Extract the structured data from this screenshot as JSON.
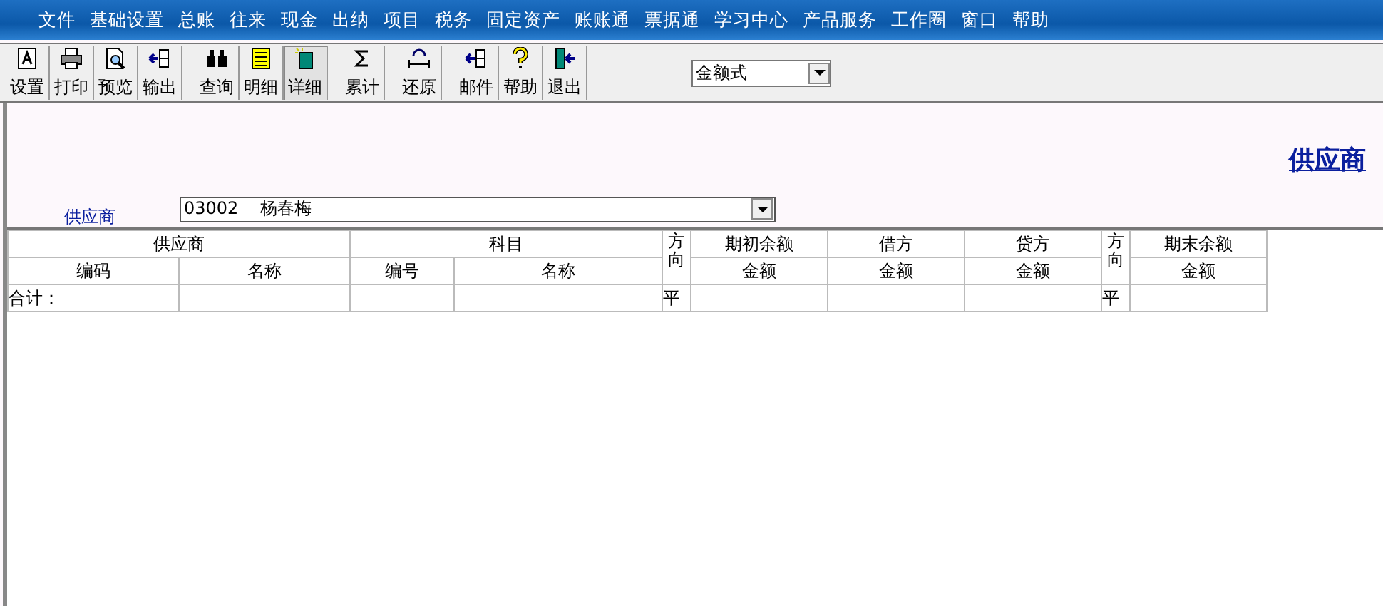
{
  "menu": [
    "文件",
    "基础设置",
    "总账",
    "往来",
    "现金",
    "出纳",
    "项目",
    "税务",
    "固定资产",
    "账账通",
    "票据通",
    "学习中心",
    "产品服务",
    "工作圈",
    "窗口",
    "帮助"
  ],
  "toolbar": [
    [
      {
        "label": "设置",
        "kind": "setup",
        "selected": false
      },
      {
        "label": "打印",
        "kind": "print",
        "selected": false
      },
      {
        "label": "预览",
        "kind": "preview",
        "selected": false
      },
      {
        "label": "输出",
        "kind": "export",
        "selected": false
      }
    ],
    [
      {
        "label": "查询",
        "kind": "find",
        "selected": false
      },
      {
        "label": "明细",
        "kind": "list",
        "selected": false
      },
      {
        "label": "详细",
        "kind": "detail",
        "selected": true
      }
    ],
    [
      {
        "label": "累计",
        "kind": "sum",
        "selected": false
      }
    ],
    [
      {
        "label": "还原",
        "kind": "restore",
        "selected": false
      }
    ],
    [
      {
        "label": "邮件",
        "kind": "export",
        "selected": false
      },
      {
        "label": "帮助",
        "kind": "help",
        "selected": false
      },
      {
        "label": "退出",
        "kind": "exit",
        "selected": false
      }
    ]
  ],
  "format_select": "金额式",
  "report_title": "供应商",
  "supplier": {
    "label": "供应商",
    "value": "03002    杨春梅"
  },
  "table": {
    "header_groups": [
      {
        "label": "供应商",
        "kind": "group",
        "columns": [
          "编码",
          "名称"
        ]
      },
      {
        "label": "科目",
        "kind": "group",
        "columns": [
          "编号",
          "名称"
        ]
      },
      {
        "label": "方向",
        "kind": "single"
      },
      {
        "label": "期初余额",
        "kind": "group",
        "columns": [
          "金额"
        ]
      },
      {
        "label": "借方",
        "kind": "group",
        "columns": [
          "金额"
        ]
      },
      {
        "label": "贷方",
        "kind": "group",
        "columns": [
          "金额"
        ]
      },
      {
        "label": "方向",
        "kind": "single"
      },
      {
        "label": "期末余额",
        "kind": "group",
        "columns": [
          "金额"
        ]
      }
    ],
    "rows": [
      [
        "合计：",
        null,
        null,
        null,
        "平",
        null,
        null,
        null,
        "平",
        null
      ]
    ]
  }
}
